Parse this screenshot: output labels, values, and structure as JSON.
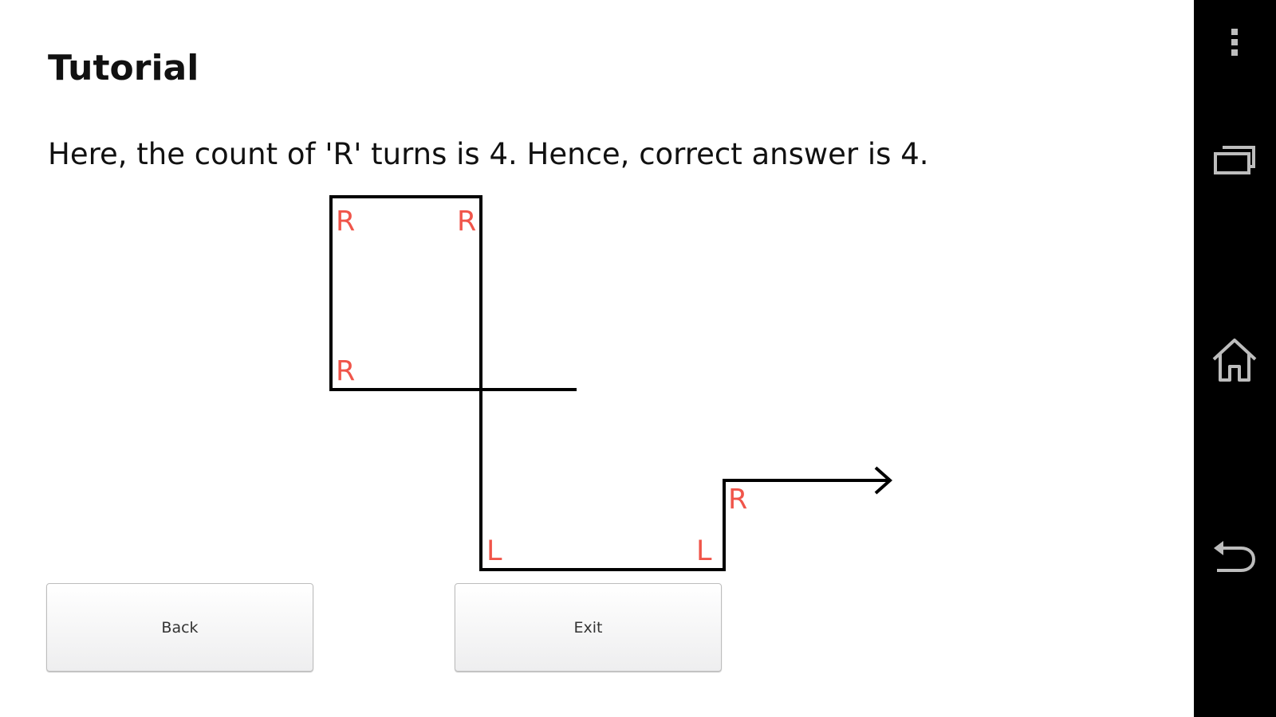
{
  "tutorial": {
    "title": "Tutorial",
    "instruction": "Here, the count of 'R' turns is 4. Hence, correct answer is 4."
  },
  "diagram": {
    "turns": [
      "R",
      "R",
      "R",
      "L",
      "L",
      "R"
    ],
    "label_color": "#f0554a"
  },
  "buttons": {
    "back_label": "Back",
    "exit_label": "Exit"
  },
  "nav_bar": {
    "icons": [
      "overflow-menu-icon",
      "recent-apps-icon",
      "home-icon",
      "back-icon"
    ]
  }
}
